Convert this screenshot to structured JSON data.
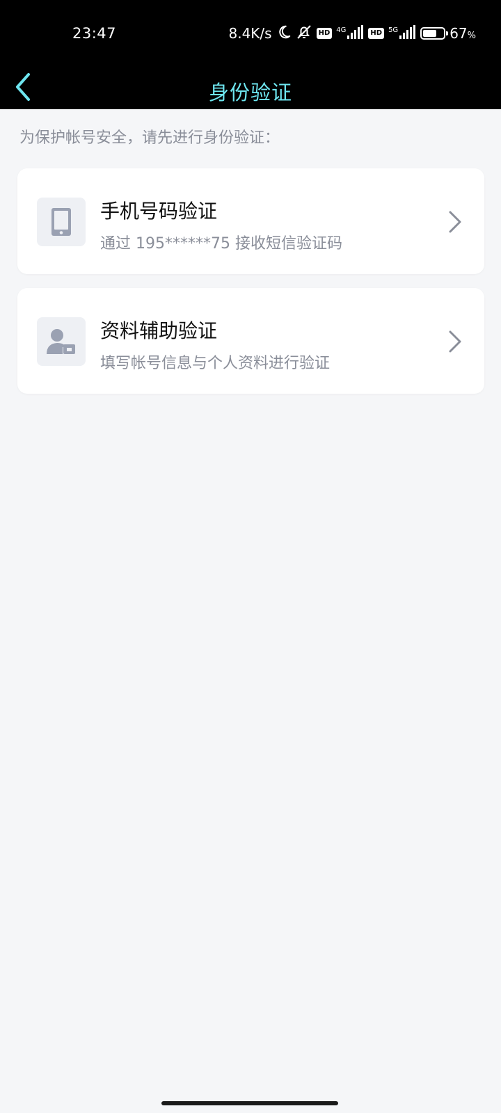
{
  "status_bar": {
    "time": "23:47",
    "net_speed": "8.4K/s",
    "sim1_badge": "HD",
    "sim1_type": "4G",
    "sim2_badge": "HD",
    "sim2_type": "5G",
    "battery_percent": "67",
    "battery_unit": "%",
    "battery_level": 0.67,
    "icons": [
      "moon-icon",
      "bell-off-icon",
      "signal-icon",
      "battery-icon"
    ]
  },
  "header": {
    "title": "身份验证",
    "back_icon": "chevron-left-icon"
  },
  "hint": "为保护帐号安全，请先进行身份验证：",
  "options": [
    {
      "title": "手机号码验证",
      "subtitle": "通过 195******75 接收短信验证码",
      "icon": "phone-icon"
    },
    {
      "title": "资料辅助验证",
      "subtitle": "填写帐号信息与个人资料进行验证",
      "icon": "user-card-icon"
    }
  ],
  "colors": {
    "accent": "#6ee6f0",
    "background": "#f5f6f8",
    "card": "#ffffff",
    "secondary_text": "#8a8e99",
    "icon_gray": "#9aa1b2"
  }
}
